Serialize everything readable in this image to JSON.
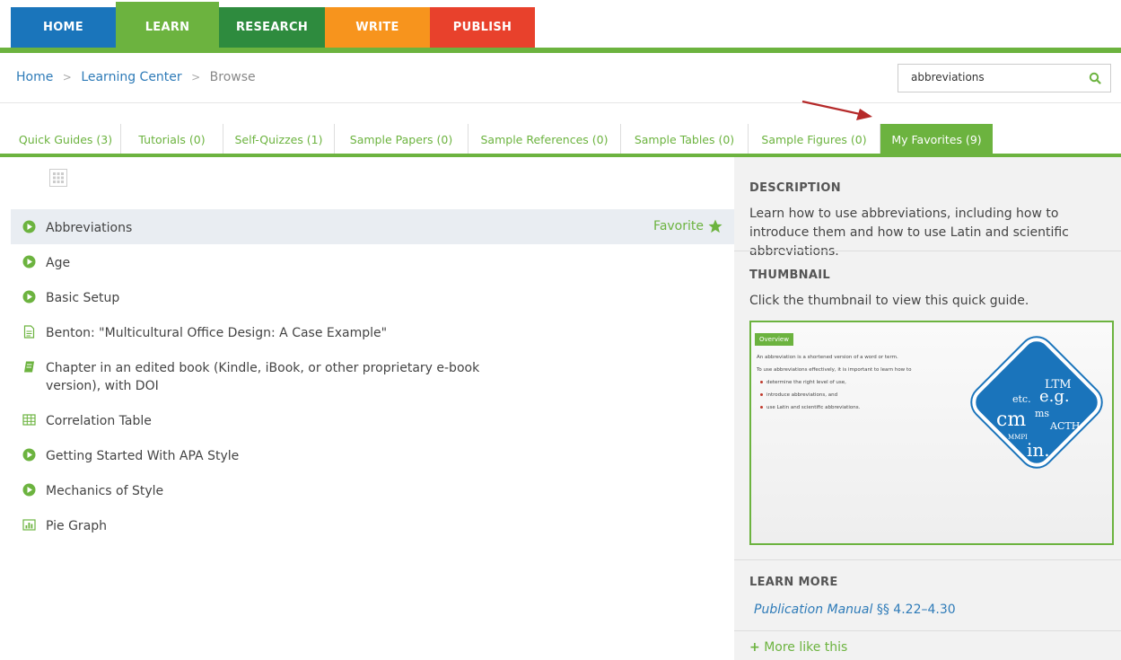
{
  "nav": {
    "tabs": [
      {
        "label": "HOME",
        "color": "#1a75bb"
      },
      {
        "label": "LEARN",
        "color": "#6cb33f"
      },
      {
        "label": "RESEARCH",
        "color": "#2e8b3e"
      },
      {
        "label": "WRITE",
        "color": "#f7941d"
      },
      {
        "label": "PUBLISH",
        "color": "#e8412c"
      }
    ]
  },
  "breadcrumb": {
    "home": "Home",
    "sep1": ">",
    "learning": "Learning Center",
    "sep2": ">",
    "current": "Browse"
  },
  "search": {
    "value": "abbreviations",
    "icon": "search-icon"
  },
  "subtabs": [
    "Quick Guides (3)",
    "Tutorials (0)",
    "Self-Quizzes (1)",
    "Sample Papers (0)",
    "Sample References (0)",
    "Sample Tables (0)",
    "Sample Figures (0)",
    "My Favorites (9)"
  ],
  "items": [
    {
      "label": "Abbreviations",
      "icon": "play-icon"
    },
    {
      "label": "Age",
      "icon": "play-icon"
    },
    {
      "label": "Basic Setup",
      "icon": "play-icon"
    },
    {
      "label": "Benton: \"Multicultural Office Design: A Case Example\"",
      "icon": "document-icon"
    },
    {
      "label": "Chapter in an edited book (Kindle, iBook, or other proprietary e-book version), with DOI",
      "icon": "book-icon"
    },
    {
      "label": "Correlation Table",
      "icon": "table-icon"
    },
    {
      "label": "Getting Started With APA Style",
      "icon": "play-icon"
    },
    {
      "label": "Mechanics of Style",
      "icon": "play-icon"
    },
    {
      "label": "Pie Graph",
      "icon": "chart-icon"
    }
  ],
  "favorite_label": "Favorite",
  "side": {
    "desc_title": "DESCRIPTION",
    "desc_text": "Learn how to use abbreviations, including how to introduce them and how to use Latin and scientific abbreviations.",
    "thumb_title": "THUMBNAIL",
    "thumb_text": "Click the thumbnail to view this quick guide.",
    "thumb": {
      "tag": "Overview",
      "line1": "An abbreviation is a shortened version of a word or term.",
      "line2": "To use abbreviations effectively, it is important to learn how to",
      "b1": "determine the right level of use,",
      "b2": "introduce abbreviations, and",
      "b3": "use Latin and scientific abbreviations.",
      "words": [
        "LTM",
        "etc.",
        "e.g.",
        "ms",
        "cm",
        "ACTH",
        "MMPI",
        "in."
      ]
    },
    "learn_title": "LEARN MORE",
    "learn_link_italic": "Publication Manual",
    "learn_link_rest": " §§ 4.22–4.30",
    "more": "More like this"
  }
}
